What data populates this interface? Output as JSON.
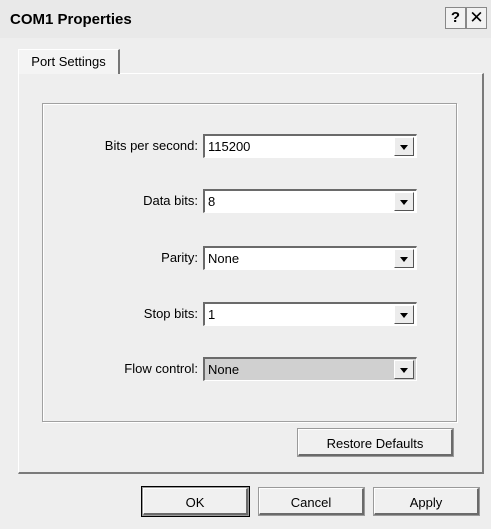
{
  "window": {
    "title": "COM1 Properties",
    "help_label": "?",
    "close_label": "✕"
  },
  "tabs": [
    {
      "label": "Port Settings",
      "active": true
    }
  ],
  "settings": [
    {
      "label": "Bits per second:",
      "value": "115200"
    },
    {
      "label": "Data bits:",
      "value": "8"
    },
    {
      "label": "Parity:",
      "value": "None"
    },
    {
      "label": "Stop bits:",
      "value": "1"
    },
    {
      "label": "Flow control:",
      "value": "None",
      "focused": true
    }
  ],
  "buttons": {
    "restore_defaults": "Restore Defaults",
    "ok": "OK",
    "cancel": "Cancel",
    "apply": "Apply"
  },
  "icons": {
    "dropdown": "chevron-down-icon"
  }
}
